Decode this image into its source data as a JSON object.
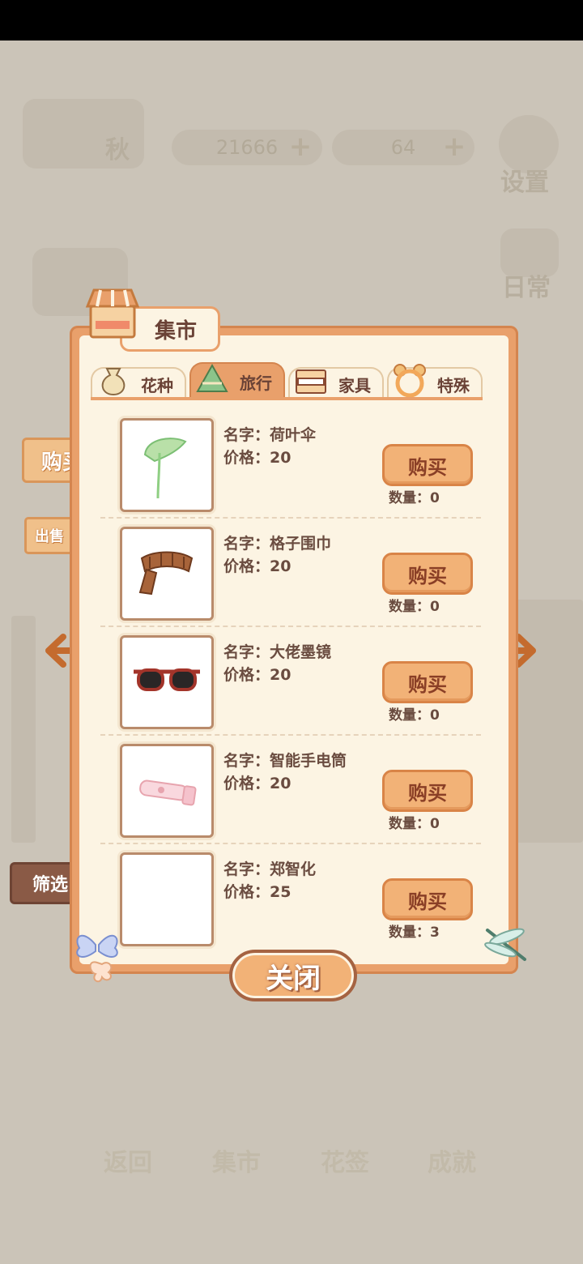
{
  "background_hud": {
    "season_label": "秋",
    "fish_amount": "21666",
    "cheese_amount": "64",
    "settings_label": "设置",
    "daily_label": "日常",
    "bottom_nav": [
      "返回",
      "集市",
      "花签",
      "成就"
    ]
  },
  "side_tabs": {
    "buy": "购买",
    "sell": "出售",
    "filter": "筛选"
  },
  "panel": {
    "title": "集市",
    "tabs": [
      {
        "label": "花种",
        "icon": "seed-bag-icon"
      },
      {
        "label": "旅行",
        "icon": "zongzi-icon"
      },
      {
        "label": "家具",
        "icon": "bed-icon"
      },
      {
        "label": "特殊",
        "icon": "bear-ring-icon"
      }
    ],
    "active_tab": "旅行",
    "items": [
      {
        "name": "名字：荷叶伞",
        "price": "价格：20",
        "buy": "购买",
        "qty": "数量：0",
        "icon": "lotus-leaf-umbrella-icon"
      },
      {
        "name": "名字：格子围巾",
        "price": "价格：20",
        "buy": "购买",
        "qty": "数量：0",
        "icon": "plaid-scarf-icon"
      },
      {
        "name": "名字：大佬墨镜",
        "price": "价格：20",
        "buy": "购买",
        "qty": "数量：0",
        "icon": "sunglasses-icon"
      },
      {
        "name": "名字：智能手电筒",
        "price": "价格：20",
        "buy": "购买",
        "qty": "数量：0",
        "icon": "flashlight-icon"
      },
      {
        "name": "名字：郑智化",
        "price": "价格：25",
        "buy": "购买",
        "qty": "数量：3",
        "icon": ""
      }
    ],
    "close": "关闭"
  },
  "colors": {
    "panel_border": "#e9a06b",
    "panel_bg": "#fcf4e3",
    "button": "#f2b277",
    "text": "#6a4c40"
  }
}
